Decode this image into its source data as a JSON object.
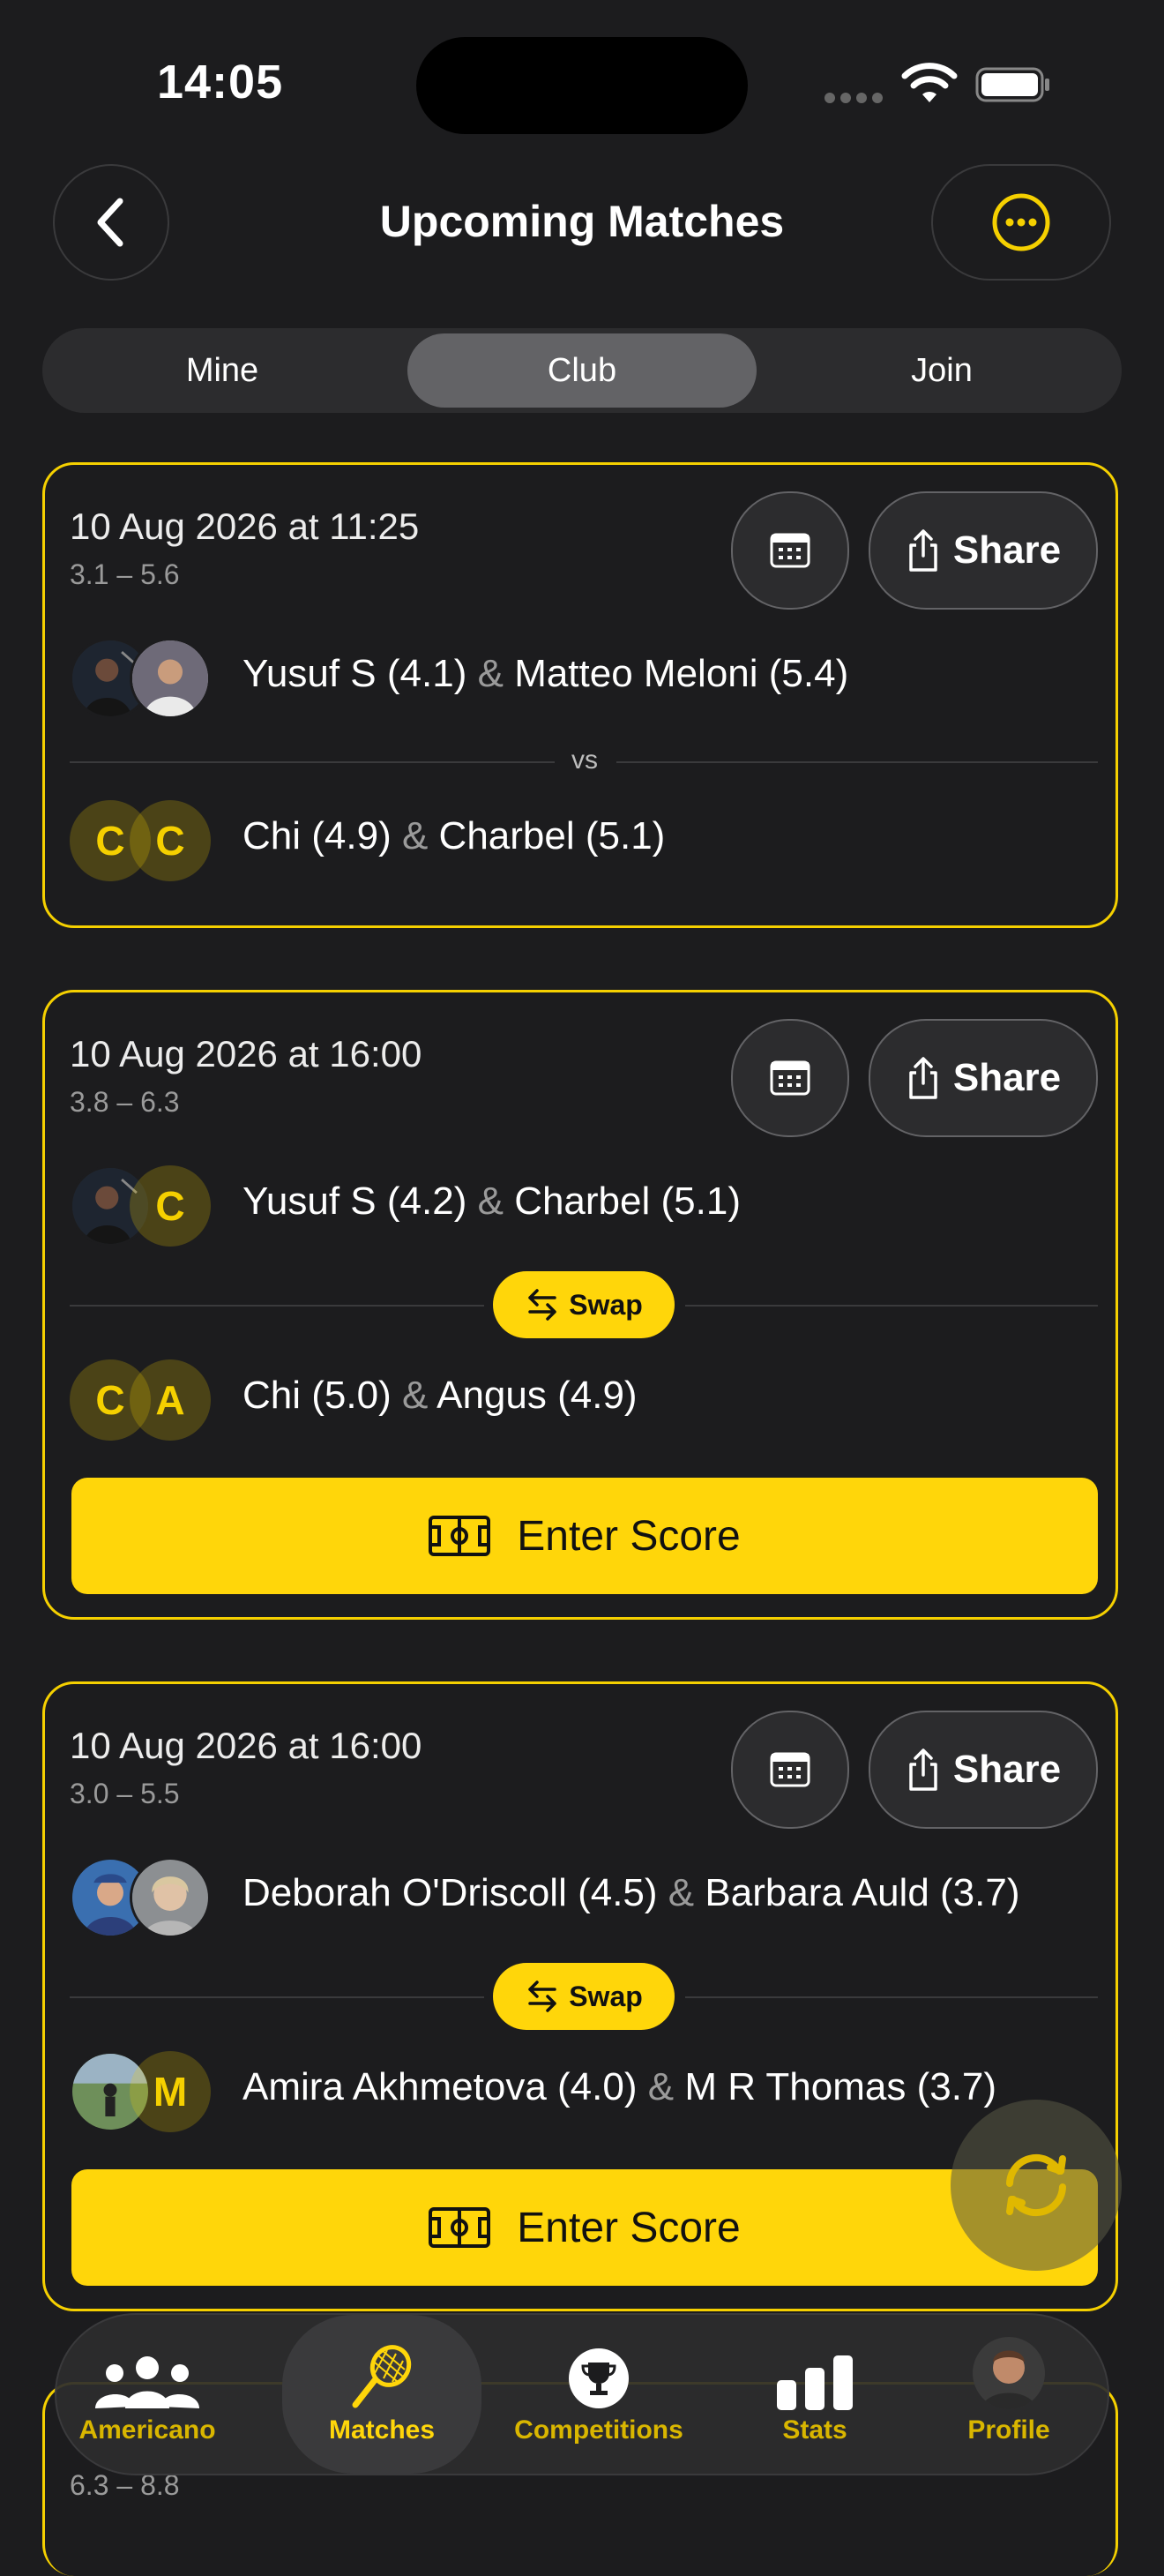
{
  "status_bar": {
    "time": "14:05"
  },
  "header": {
    "title": "Upcoming Matches"
  },
  "segments": [
    {
      "label": "Mine",
      "active": false
    },
    {
      "label": "Club",
      "active": true
    },
    {
      "label": "Join",
      "active": false
    }
  ],
  "share_label": "Share",
  "swap_label": "Swap",
  "enter_score_label": "Enter Score",
  "vs_label": "vs",
  "amp": "&",
  "matches": [
    {
      "date": "10 Aug 2026 at 11:25",
      "range": "3.1 – 5.6",
      "team1": {
        "p1": "Yusuf S (4.1)",
        "p2": "Matteo Meloni (5.4)"
      },
      "team2": {
        "p1": "Chi (4.9)",
        "p2": "Charbel (5.1)",
        "initials": [
          "C",
          "C"
        ]
      }
    },
    {
      "date": "10 Aug 2026 at 16:00",
      "range": "3.8 – 6.3",
      "team1": {
        "p1": "Yusuf S (4.2)",
        "p2": "Charbel (5.1)",
        "initials": [
          "C"
        ]
      },
      "team2": {
        "p1": "Chi (5.0)",
        "p2": "Angus (4.9)",
        "initials": [
          "C",
          "A"
        ]
      }
    },
    {
      "date": "10 Aug 2026 at 16:00",
      "range": "3.0 – 5.5",
      "team1": {
        "p1": "Deborah O'Driscoll (4.5)",
        "p2": "Barbara Auld (3.7)"
      },
      "team2": {
        "p1": "Amira Akhmetova  (4.0)",
        "p2": "M R Thomas  (3.7)",
        "initials": [
          "M"
        ]
      }
    },
    {
      "range": "6.3 – 8.8"
    }
  ],
  "tabs": [
    {
      "label": "Americano",
      "icon": "people-icon"
    },
    {
      "label": "Matches",
      "icon": "racket-icon",
      "active": true
    },
    {
      "label": "Competitions",
      "icon": "trophy-icon"
    },
    {
      "label": "Stats",
      "icon": "bar-chart-icon"
    },
    {
      "label": "Profile",
      "icon": "avatar"
    }
  ],
  "colors": {
    "accent": "#ffd60a",
    "card_border": "#f5d000",
    "background": "#1c1c1e"
  }
}
